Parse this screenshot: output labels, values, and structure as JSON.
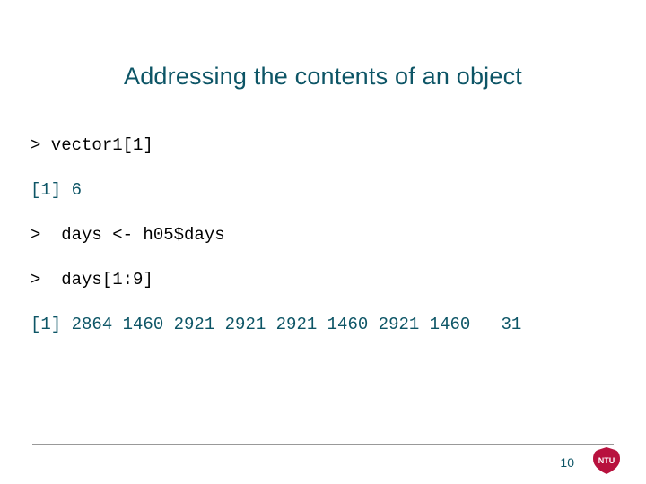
{
  "title": "Addressing the contents of an object",
  "code": {
    "l1": "> vector1[1]",
    "l2": "[1] 6",
    "l3": ">  days <- h05$days",
    "l4": ">  days[1:9]",
    "l5": "[1] 2864 1460 2921 2921 2921 1460 2921 1460   31"
  },
  "page_number": "10",
  "logo": {
    "text": "NTU",
    "color": "#b8123e"
  }
}
